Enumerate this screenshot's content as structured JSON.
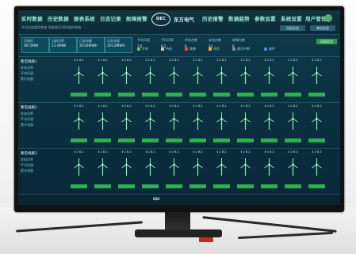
{
  "nav_left": [
    "实时数据",
    "历史数据",
    "报表系统",
    "日志记录",
    "故障报警"
  ],
  "brand_logo": "DEC",
  "brand_name": "东方电气",
  "nav_right": [
    "历史报警",
    "数据趋势",
    "参数设置",
    "系统设置",
    "用户管理"
  ],
  "subtitle": "东方风电监控系统 风电场SCADA监控系统",
  "stat_boxes": [
    {
      "title": "总装机",
      "value": "49.5MW"
    },
    {
      "title": "当前功率",
      "value": "12.6MW"
    },
    {
      "title": "日发电量",
      "value": "2016MWh"
    },
    {
      "title": "总发电量",
      "value": "2013MWh"
    }
  ],
  "metrics": [
    {
      "label": "平均风速",
      "value": "7.6"
    },
    {
      "label": "平均功率",
      "value": "6.2"
    },
    {
      "label": "待机台数",
      "value": "0"
    },
    {
      "label": "发电台数",
      "value": "33"
    },
    {
      "label": "故障台数",
      "value": "0"
    }
  ],
  "top_buttons": [
    "风机总览",
    "单机信息"
  ],
  "legend": [
    "并网",
    "待机",
    "故障",
    "停机",
    "通讯中断",
    "维护"
  ],
  "groups": [
    {
      "name": "集电线路1",
      "rows": [
        "发电功率",
        "平均风速",
        "累计电量"
      ],
      "units": 11
    },
    {
      "name": "集电线路2",
      "rows": [
        "发电功率",
        "平均风速",
        "累计电量"
      ],
      "units": 11
    },
    {
      "name": "集电线路3",
      "rows": [
        "发电功率",
        "平均风速",
        "累计电量"
      ],
      "units": 11
    }
  ],
  "unit_top_text": "4.1 8.2",
  "monitor_brand": "DEC"
}
